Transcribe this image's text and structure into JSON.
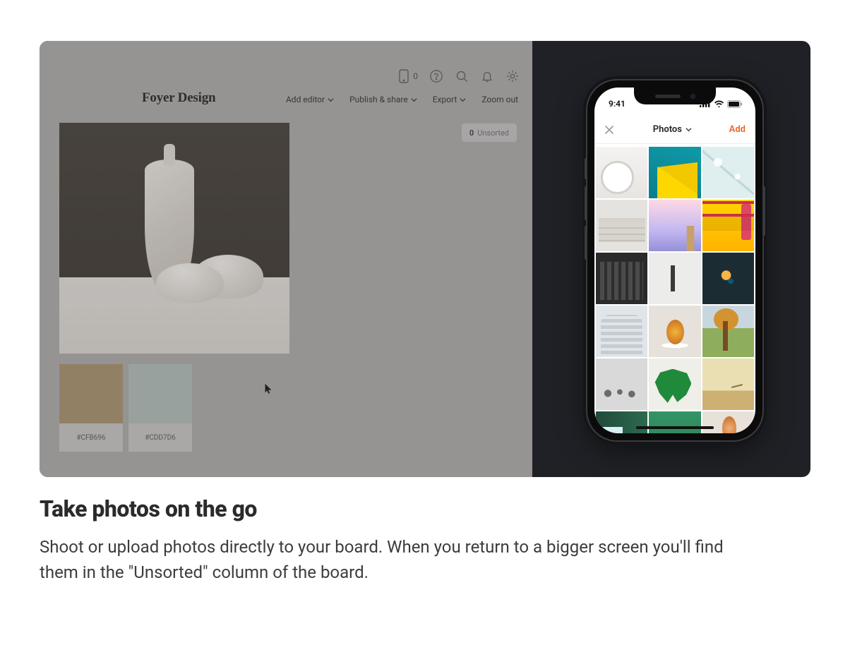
{
  "desktop": {
    "board_title": "Foyer Design",
    "topbar_phone_count": "0",
    "menu": {
      "add_editor": "Add editor",
      "publish_share": "Publish & share",
      "export": "Export",
      "zoom_out": "Zoom out"
    },
    "unsorted": {
      "count": "0",
      "label": "Unsorted"
    },
    "swatches": [
      {
        "hex": "#CFB696"
      },
      {
        "hex": "#CDD7D6"
      }
    ]
  },
  "phone": {
    "status_time": "9:41",
    "header_title": "Photos",
    "add_label": "Add"
  },
  "caption": {
    "title": "Take photos on the go",
    "body": "Shoot or upload photos directly to your board. When you return to a bigger screen you'll find them in the \"Unsorted\" column of the board."
  }
}
